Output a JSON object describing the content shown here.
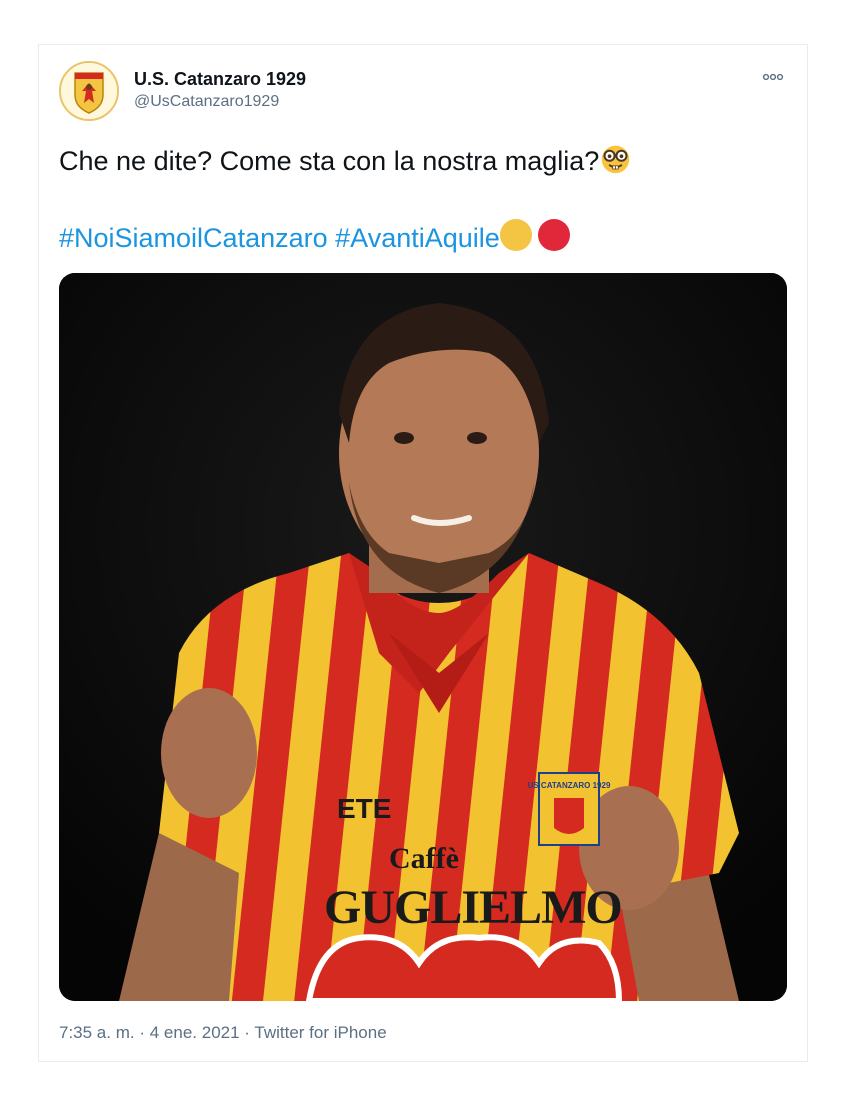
{
  "account": {
    "display_name": "U.S. Catanzaro 1929",
    "handle": "@UsCatanzaro1929"
  },
  "more_icon": "ellipsis-icon",
  "tweet": {
    "text_line1": "Che ne dite? Come sta con la nostra maglia?",
    "emoji_line1": "nerd-face-emoji",
    "hashtag1": "#NoiSiamoilCatanzaro",
    "hashtag2": "#AvantiAquile",
    "circle_colors": [
      "#f4c542",
      "#e0283a"
    ]
  },
  "media": {
    "sponsor_top": "Caffè",
    "sponsor_main": "GUGLIELMO",
    "kit_brand": "ETE",
    "crest_text": "US CATANZARO 1929",
    "shirt_colors": {
      "red": "#d42a1f",
      "yellow": "#f2c230"
    }
  },
  "meta": {
    "time": "7:35 a. m.",
    "date": "4 ene. 2021",
    "source": "Twitter for iPhone",
    "separator": "·"
  }
}
